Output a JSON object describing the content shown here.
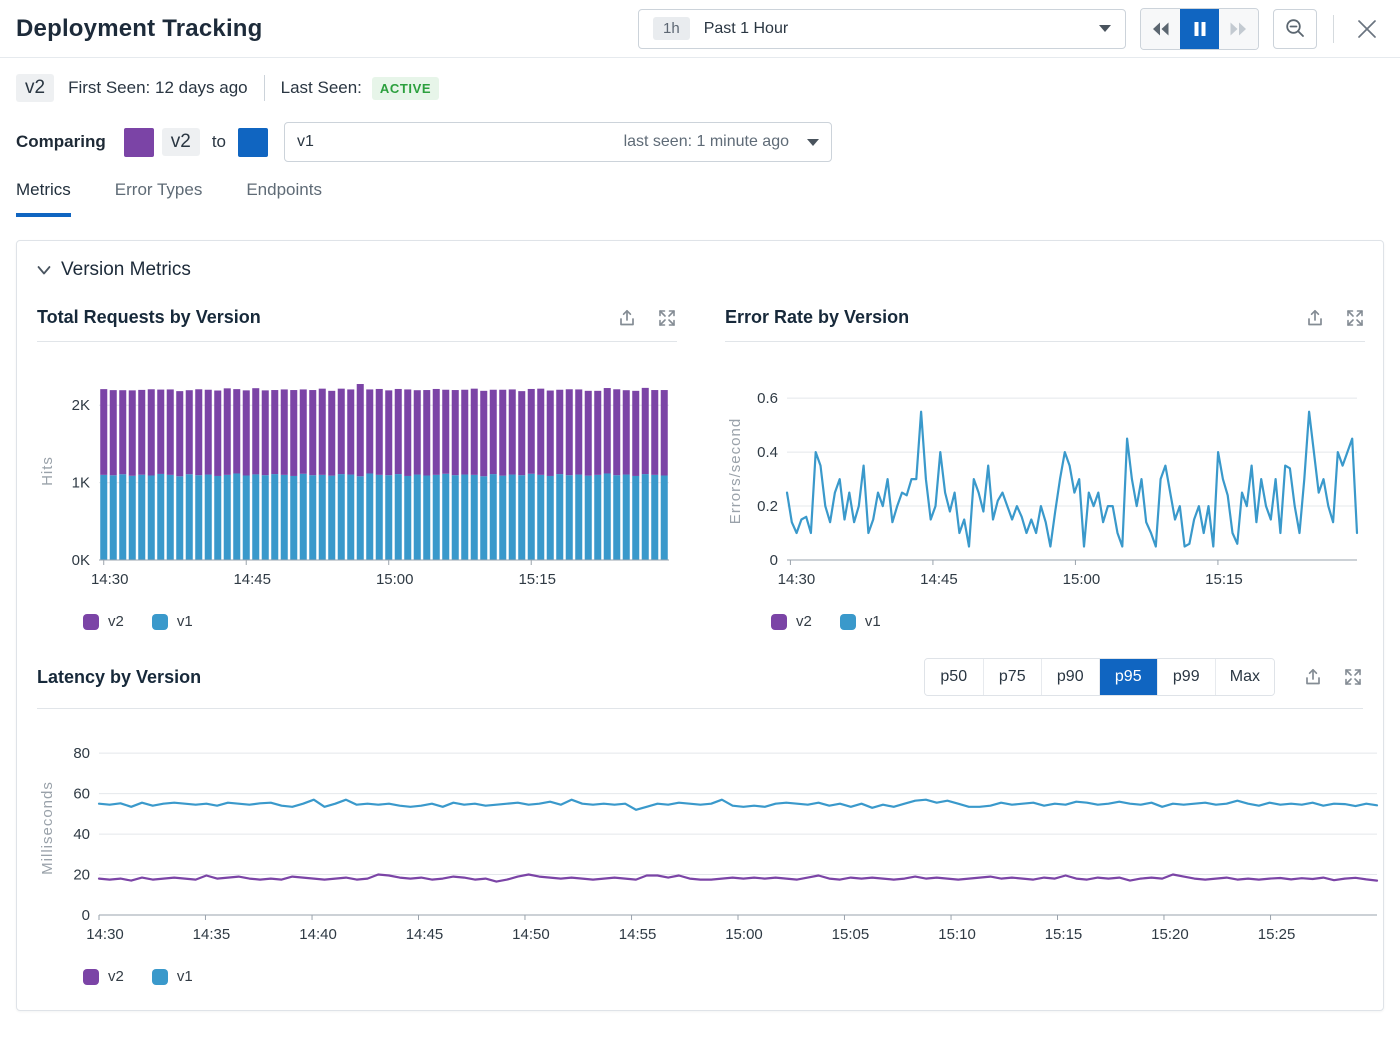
{
  "header": {
    "title": "Deployment Tracking",
    "time_badge": "1h",
    "time_label": "Past 1 Hour"
  },
  "version_bar": {
    "version": "v2",
    "first_seen": "First Seen: 12 days ago",
    "last_seen_label": "Last Seen:",
    "status": "ACTIVE"
  },
  "comparing": {
    "label": "Comparing",
    "left_version": "v2",
    "to_label": "to",
    "right_version": "v1",
    "last_seen": "last seen: 1 minute ago"
  },
  "tabs": {
    "items": [
      "Metrics",
      "Error Types",
      "Endpoints"
    ],
    "active": "Metrics"
  },
  "section": {
    "title": "Version Metrics"
  },
  "percentiles": {
    "options": [
      "p50",
      "p75",
      "p90",
      "p95",
      "p99",
      "Max"
    ],
    "selected": "p95"
  },
  "legend": [
    {
      "label": "v2",
      "color": "#7b44a6"
    },
    {
      "label": "v1",
      "color": "#3a99cb"
    }
  ],
  "colors": {
    "v2_purple": "#7b44a6",
    "v1_blue": "#3a99cb",
    "accent_blue": "#1065c1",
    "active_green": "#2ca03e",
    "active_green_bg": "#e7f5e9"
  },
  "icons": {
    "playback": [
      "rewind-icon",
      "pause-icon",
      "fast-forward-icon"
    ],
    "zoom_out": "magnifier-minus-icon",
    "close": "x-icon",
    "chart_actions": [
      "export-icon",
      "expand-icon"
    ],
    "section": "chevron-down-icon",
    "dropdowns": "caret-down-icon"
  },
  "chart_data": [
    {
      "type": "bar",
      "stacked": true,
      "title": "Total Requests by Version",
      "ylabel": "Hits",
      "ylim": [
        0,
        2300
      ],
      "yticks": [
        {
          "v": 0,
          "label": "0K"
        },
        {
          "v": 1000,
          "label": "1K"
        },
        {
          "v": 2000,
          "label": "2K"
        }
      ],
      "xticks": [
        {
          "frac": 0.0083,
          "label": "14:30"
        },
        {
          "frac": 0.2583,
          "label": "14:45"
        },
        {
          "frac": 0.5083,
          "label": "15:00"
        },
        {
          "frac": 0.7583,
          "label": "15:15"
        }
      ],
      "legend_position": "bottom",
      "grid": true,
      "series": [
        {
          "name": "v1",
          "color": "#3a99cb",
          "values": [
            1100,
            1095,
            1108,
            1088,
            1102,
            1092,
            1112,
            1100,
            1082,
            1108,
            1096,
            1104,
            1086,
            1100,
            1118,
            1092,
            1106,
            1096,
            1110,
            1100,
            1086,
            1114,
            1096,
            1100,
            1090,
            1110,
            1104,
            1082,
            1118,
            1100,
            1096,
            1110,
            1086,
            1104,
            1092,
            1100,
            1114,
            1096,
            1104,
            1100,
            1082,
            1110,
            1090,
            1104,
            1096,
            1114,
            1100,
            1086,
            1110,
            1096,
            1104,
            1090,
            1100,
            1118,
            1096,
            1104,
            1086,
            1110,
            1100,
            1092
          ]
        },
        {
          "name": "v2",
          "color": "#7b44a6",
          "values": [
            1108,
            1100,
            1086,
            1104,
            1096,
            1114,
            1090,
            1104,
            1100,
            1086,
            1110,
            1096,
            1104,
            1118,
            1090,
            1100,
            1114,
            1096,
            1086,
            1104,
            1110,
            1090,
            1100,
            1114,
            1096,
            1104,
            1100,
            1192,
            1086,
            1110,
            1096,
            1100,
            1118,
            1090,
            1104,
            1110,
            1086,
            1100,
            1096,
            1114,
            1104,
            1090,
            1110,
            1100,
            1086,
            1096,
            1114,
            1104,
            1090,
            1110,
            1100,
            1096,
            1086,
            1104,
            1110,
            1090,
            1100,
            1114,
            1096,
            1104
          ]
        }
      ]
    },
    {
      "type": "line",
      "title": "Error Rate by Version",
      "ylabel": "Errors/second",
      "ylim": [
        0,
        0.66
      ],
      "yticks": [
        {
          "v": 0,
          "label": "0"
        },
        {
          "v": 0.2,
          "label": "0.2"
        },
        {
          "v": 0.4,
          "label": "0.4"
        },
        {
          "v": 0.6,
          "label": "0.6"
        }
      ],
      "xticks": [
        {
          "frac": 0.006,
          "label": "14:30"
        },
        {
          "frac": 0.256,
          "label": "14:45"
        },
        {
          "frac": 0.506,
          "label": "15:00"
        },
        {
          "frac": 0.756,
          "label": "15:15"
        }
      ],
      "legend_position": "bottom",
      "grid": true,
      "series": [
        {
          "name": "v1",
          "color": "#3a99cb",
          "values": [
            0.25,
            0.14,
            0.1,
            0.15,
            0.16,
            0.1,
            0.4,
            0.35,
            0.2,
            0.14,
            0.25,
            0.3,
            0.15,
            0.25,
            0.14,
            0.2,
            0.35,
            0.1,
            0.15,
            0.25,
            0.2,
            0.3,
            0.14,
            0.2,
            0.25,
            0.24,
            0.3,
            0.3,
            0.55,
            0.3,
            0.15,
            0.2,
            0.4,
            0.25,
            0.18,
            0.25,
            0.1,
            0.15,
            0.05,
            0.3,
            0.25,
            0.18,
            0.35,
            0.15,
            0.22,
            0.25,
            0.2,
            0.15,
            0.2,
            0.16,
            0.1,
            0.15,
            0.1,
            0.2,
            0.14,
            0.05,
            0.18,
            0.3,
            0.4,
            0.35,
            0.25,
            0.3,
            0.05,
            0.25,
            0.2,
            0.25,
            0.14,
            0.2,
            0.2,
            0.1,
            0.05,
            0.45,
            0.3,
            0.2,
            0.3,
            0.14,
            0.1,
            0.05,
            0.3,
            0.35,
            0.25,
            0.15,
            0.2,
            0.05,
            0.06,
            0.15,
            0.2,
            0.1,
            0.2,
            0.05,
            0.4,
            0.3,
            0.24,
            0.1,
            0.06,
            0.25,
            0.2,
            0.35,
            0.14,
            0.3,
            0.2,
            0.15,
            0.3,
            0.1,
            0.35,
            0.34,
            0.2,
            0.1,
            0.3,
            0.55,
            0.4,
            0.25,
            0.3,
            0.2,
            0.14,
            0.4,
            0.35,
            0.4,
            0.45,
            0.1
          ]
        }
      ]
    },
    {
      "type": "line",
      "title": "Latency by Version",
      "ylabel": "Milliseconds",
      "ylim": [
        0,
        86
      ],
      "yticks": [
        {
          "v": 0,
          "label": "0"
        },
        {
          "v": 20,
          "label": "20"
        },
        {
          "v": 40,
          "label": "40"
        },
        {
          "v": 60,
          "label": "60"
        },
        {
          "v": 80,
          "label": "80"
        }
      ],
      "xticks": [
        {
          "frac": 0.0,
          "label": "14:30"
        },
        {
          "frac": 0.0833,
          "label": "14:35"
        },
        {
          "frac": 0.1667,
          "label": "14:40"
        },
        {
          "frac": 0.25,
          "label": "14:45"
        },
        {
          "frac": 0.3333,
          "label": "14:50"
        },
        {
          "frac": 0.4167,
          "label": "14:55"
        },
        {
          "frac": 0.5,
          "label": "15:00"
        },
        {
          "frac": 0.5833,
          "label": "15:05"
        },
        {
          "frac": 0.6667,
          "label": "15:10"
        },
        {
          "frac": 0.75,
          "label": "15:15"
        },
        {
          "frac": 0.8333,
          "label": "15:20"
        },
        {
          "frac": 0.9167,
          "label": "15:25"
        }
      ],
      "legend_position": "bottom",
      "grid": true,
      "series": [
        {
          "name": "v1",
          "color": "#3a99cb",
          "values": [
            55,
            54.5,
            55.2,
            53.5,
            55.5,
            54,
            55,
            55.5,
            55,
            54.5,
            55,
            54,
            55.5,
            55,
            54.5,
            55.2,
            55.5,
            54,
            53.5,
            55,
            57,
            53.5,
            55,
            57,
            54.5,
            55,
            54.5,
            55,
            54,
            53.5,
            54,
            55,
            53.5,
            55.5,
            54.5,
            55,
            54,
            54.5,
            55,
            55.5,
            54.5,
            55,
            56,
            54.5,
            57,
            55,
            54.5,
            55,
            54.5,
            55,
            52,
            53.5,
            55,
            54.5,
            55.5,
            55,
            54.5,
            55,
            57,
            54,
            53.5,
            54,
            53.5,
            55,
            55.5,
            55,
            54.5,
            55.5,
            54,
            55,
            53.5,
            55,
            53,
            54.5,
            53.5,
            55,
            56.5,
            57,
            55.5,
            56.5,
            55,
            53.5,
            53.5,
            54,
            55.5,
            54.5,
            55,
            55.5,
            54,
            55,
            54.5,
            56,
            55.5,
            54.5,
            55,
            56,
            55,
            54.5,
            55.5,
            53.5,
            55,
            54.5,
            55,
            55.5,
            54.5,
            55,
            56.5,
            55,
            54,
            55.5,
            54.5,
            55,
            54.5,
            55.5,
            54,
            55,
            54.8,
            53.8,
            55,
            54.2
          ]
        },
        {
          "name": "v2",
          "color": "#7b44a6",
          "values": [
            18,
            17.5,
            18,
            17,
            18.5,
            17.5,
            18,
            18.5,
            18,
            17.5,
            19.5,
            18,
            18.5,
            19,
            18,
            17.5,
            18,
            17.5,
            19,
            18.5,
            18,
            17.5,
            18,
            18.5,
            17.5,
            18,
            20,
            19.5,
            18.5,
            18,
            18.5,
            17.5,
            18,
            19,
            18.5,
            17.5,
            18,
            16.5,
            17.5,
            19,
            20,
            19,
            18.5,
            18,
            18.5,
            18,
            17.5,
            18,
            18.5,
            18,
            17.5,
            19.5,
            19.5,
            18.5,
            19.5,
            18,
            17.5,
            17.5,
            18,
            18.5,
            18,
            18.5,
            18,
            18.5,
            18,
            17.5,
            18.5,
            19.5,
            18,
            17.5,
            18.5,
            18,
            18.5,
            18,
            17.5,
            18,
            19,
            18,
            18.5,
            18,
            17.5,
            18,
            18.5,
            19,
            18,
            18.5,
            18,
            17.5,
            18.5,
            18,
            19.5,
            18,
            17.5,
            18.5,
            18,
            18.5,
            17,
            18,
            18.5,
            18,
            20,
            19,
            18,
            17.5,
            18,
            18.5,
            17.5,
            18,
            17.5,
            18,
            18.3,
            17.6,
            18.2,
            17.8,
            18.5,
            17.2,
            18,
            18.4,
            17.6,
            17
          ]
        }
      ]
    }
  ]
}
